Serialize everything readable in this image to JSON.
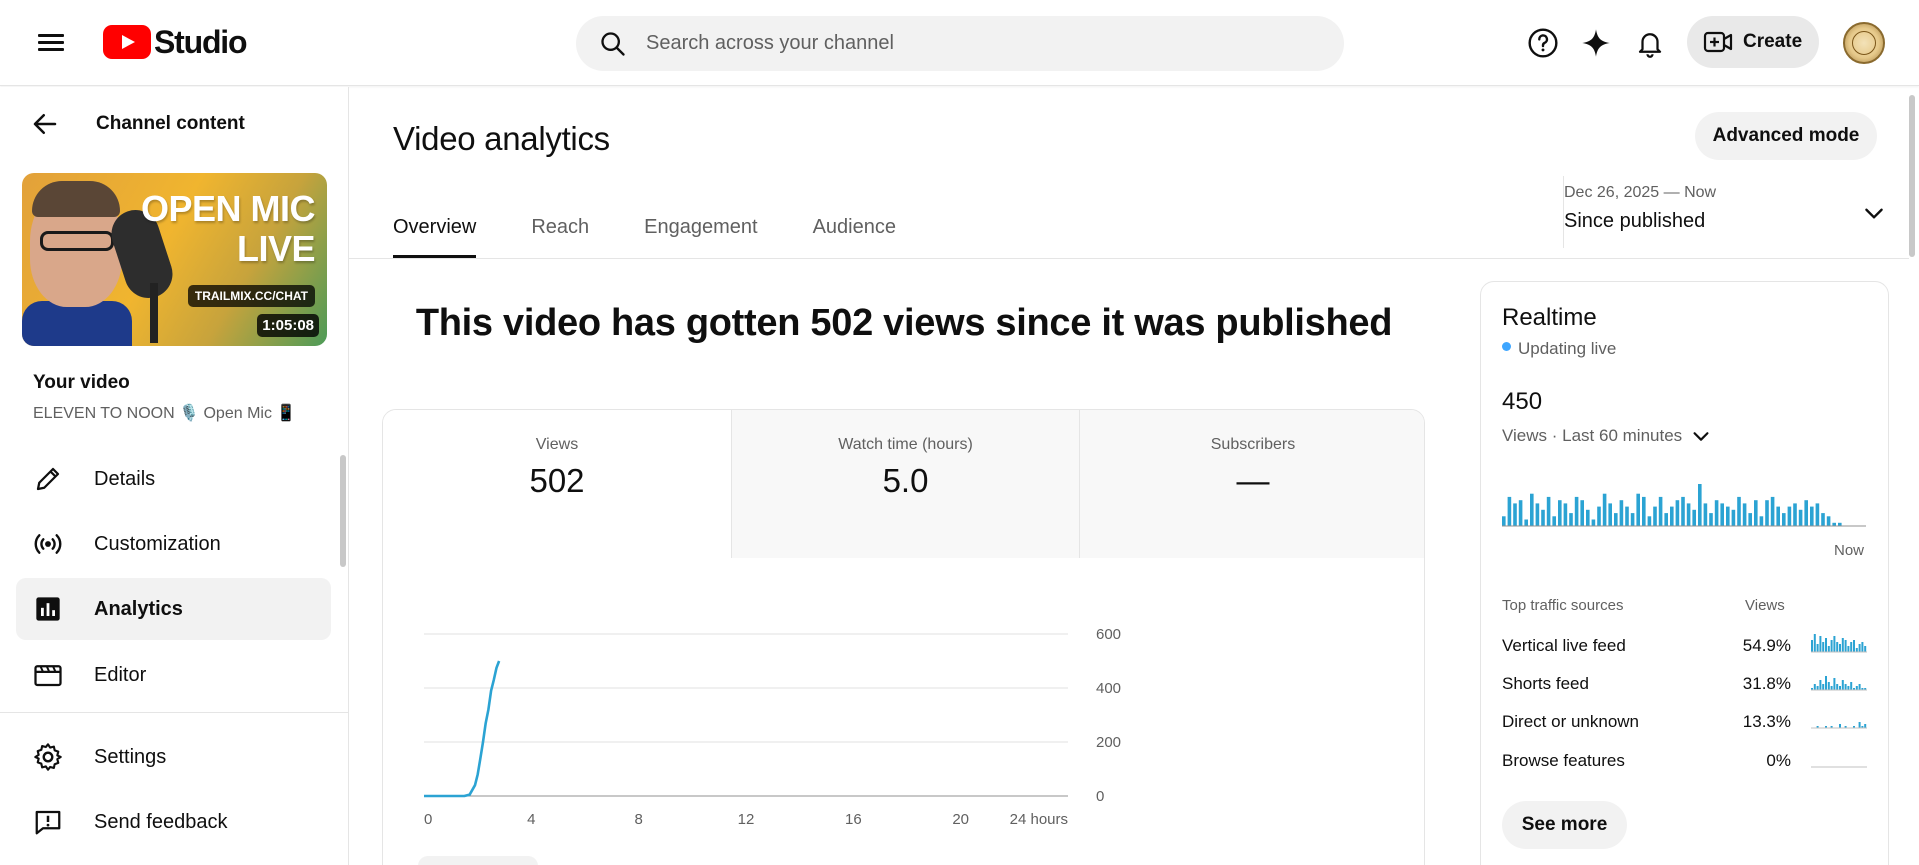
{
  "header": {
    "logo_text": "Studio",
    "search_placeholder": "Search across your channel",
    "create_label": "Create"
  },
  "sidebar": {
    "back_label": "Channel content",
    "thumbnail": {
      "title_line1": "OPEN MIC",
      "title_line2": "LIVE",
      "url": "TRAILMIX.CC/CHAT",
      "duration": "1:05:08"
    },
    "your_video_label": "Your video",
    "video_title": "ELEVEN TO NOON 🎙️ Open Mic 📱",
    "items": [
      {
        "label": "Details",
        "icon": "pencil-icon"
      },
      {
        "label": "Customization",
        "icon": "broadcast-icon"
      },
      {
        "label": "Analytics",
        "icon": "analytics-icon",
        "active": true
      },
      {
        "label": "Editor",
        "icon": "clapper-icon"
      },
      {
        "label": "Settings",
        "icon": "gear-icon"
      },
      {
        "label": "Send feedback",
        "icon": "feedback-icon"
      }
    ]
  },
  "main": {
    "title": "Video analytics",
    "advanced_mode_label": "Advanced mode",
    "tabs": [
      {
        "label": "Overview",
        "active": true
      },
      {
        "label": "Reach"
      },
      {
        "label": "Engagement"
      },
      {
        "label": "Audience"
      }
    ],
    "date_range": "Dec 26, 2025 — Now",
    "date_preset": "Since published",
    "headline": "This video has gotten 502 views since it was published",
    "metrics": [
      {
        "label": "Views",
        "value": "502"
      },
      {
        "label": "Watch time (hours)",
        "value": "5.0"
      },
      {
        "label": "Subscribers",
        "value": "—"
      }
    ]
  },
  "chart_data": {
    "type": "line",
    "x_ticks": [
      "0",
      "4",
      "8",
      "12",
      "16",
      "20",
      "24 hours"
    ],
    "y_ticks": [
      "0",
      "200",
      "400",
      "600"
    ],
    "xlim": [
      0,
      24
    ],
    "ylim": [
      0,
      600
    ],
    "series": [
      {
        "color": "#2ba3d3",
        "x": [
          0,
          0.5,
          1.0,
          1.5,
          1.7,
          1.9,
          2.0,
          2.1,
          2.2,
          2.3,
          2.4,
          2.5,
          2.6,
          2.7,
          2.8
        ],
        "y": [
          0,
          0,
          0,
          0,
          5,
          40,
          80,
          140,
          200,
          270,
          320,
          390,
          430,
          475,
          500
        ]
      }
    ]
  },
  "realtime": {
    "title": "Realtime",
    "status": "Updating live",
    "count": "450",
    "subtitle": "Views · Last 60 minutes",
    "now_label": "Now",
    "bars": [
      3,
      9,
      7,
      8,
      2,
      10,
      7,
      5,
      9,
      3,
      8,
      7,
      4,
      9,
      8,
      5,
      2,
      6,
      10,
      7,
      4,
      8,
      6,
      4,
      10,
      9,
      3,
      6,
      9,
      4,
      6,
      8,
      9,
      7,
      5,
      13,
      7,
      4,
      8,
      7,
      6,
      5,
      9,
      7,
      4,
      8,
      3,
      8,
      9,
      6,
      4,
      6,
      7,
      5,
      8,
      6,
      7,
      4,
      3,
      1,
      1,
      0,
      0,
      0,
      0
    ],
    "traffic_header": {
      "source": "Top traffic sources",
      "views": "Views"
    },
    "traffic_sources": [
      {
        "name": "Vertical live feed",
        "pct": "54.9%",
        "spark": [
          6,
          9,
          4,
          8,
          5,
          7,
          3,
          6,
          8,
          5,
          4,
          7,
          6,
          3,
          5,
          6,
          2,
          4,
          5,
          3
        ]
      },
      {
        "name": "Shorts feed",
        "pct": "31.8%",
        "spark": [
          1,
          3,
          2,
          5,
          3,
          7,
          4,
          2,
          6,
          3,
          2,
          5,
          3,
          2,
          4,
          1,
          2,
          3,
          1,
          1
        ]
      },
      {
        "name": "Direct or unknown",
        "pct": "13.3%",
        "spark": [
          0,
          0,
          1,
          0,
          0,
          1,
          0,
          1,
          0,
          0,
          2,
          0,
          1,
          0,
          0,
          1,
          0,
          3,
          1,
          2
        ]
      },
      {
        "name": "Browse features",
        "pct": "0%",
        "spark": [
          0,
          0,
          0,
          0,
          0,
          0,
          0,
          0,
          0,
          0,
          0,
          0,
          0,
          0,
          0,
          0,
          0,
          0,
          0,
          0
        ]
      }
    ],
    "see_more_label": "See more"
  },
  "colors": {
    "accent": "#2ba3d3",
    "brand_red": "#ff0000",
    "live_dot": "#3ea6ff"
  }
}
